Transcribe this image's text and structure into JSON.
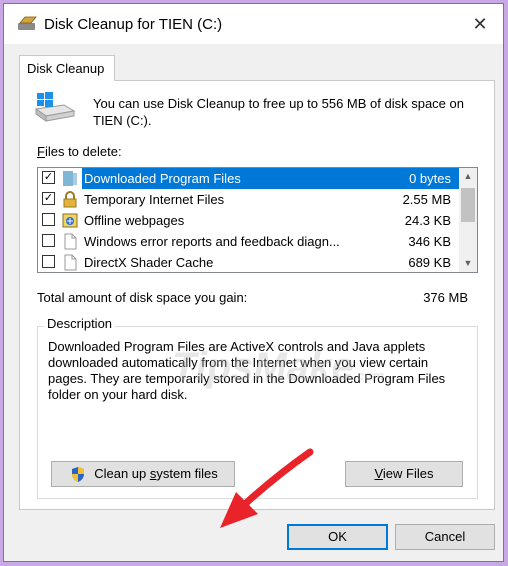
{
  "window": {
    "title": "Disk Cleanup for TIEN (C:)",
    "close_glyph": "✕",
    "title_icon": "disk-cleanup-icon"
  },
  "tab": {
    "label": "Disk Cleanup"
  },
  "intro": {
    "text": "You can use Disk Cleanup to free up to 556 MB of disk space on TIEN (C:).",
    "icon": "drive-icon"
  },
  "files_label": {
    "accel": "F",
    "rest": "iles to delete:"
  },
  "files": [
    {
      "name": "Downloaded Program Files",
      "size": "0 bytes",
      "checked": true,
      "selected": true,
      "icon": "folder-icon"
    },
    {
      "name": "Temporary Internet Files",
      "size": "2.55 MB",
      "checked": true,
      "selected": false,
      "icon": "lock-icon"
    },
    {
      "name": "Offline webpages",
      "size": "24.3 KB",
      "checked": false,
      "selected": false,
      "icon": "offline-webpages-icon"
    },
    {
      "name": "Windows error reports and feedback diagn...",
      "size": "346 KB",
      "checked": false,
      "selected": false,
      "icon": "file-icon"
    },
    {
      "name": "DirectX Shader Cache",
      "size": "689 KB",
      "checked": false,
      "selected": false,
      "icon": "file-icon"
    }
  ],
  "check_glyph": "✓",
  "scroll": {
    "up_glyph": "▲",
    "down_glyph": "▼"
  },
  "total": {
    "label": "Total amount of disk space you gain:",
    "value": "376 MB"
  },
  "description": {
    "legend": "Description",
    "text": "Downloaded Program Files are ActiveX controls and Java applets downloaded automatically from the Internet when you view certain pages. They are temporarily stored in the Downloaded Program Files folder on your hard disk."
  },
  "buttons": {
    "clean_before": "Clean up ",
    "clean_accel": "s",
    "clean_after": "ystem files",
    "view_accel": "V",
    "view_rest": "iew Files",
    "ok": "OK",
    "cancel": "Cancel"
  },
  "watermark": {
    "main": "TipsMake",
    "small": ".com"
  },
  "colors": {
    "selection": "#0078d7",
    "background": "#c9a8e6",
    "arrow": "#e8232a"
  }
}
